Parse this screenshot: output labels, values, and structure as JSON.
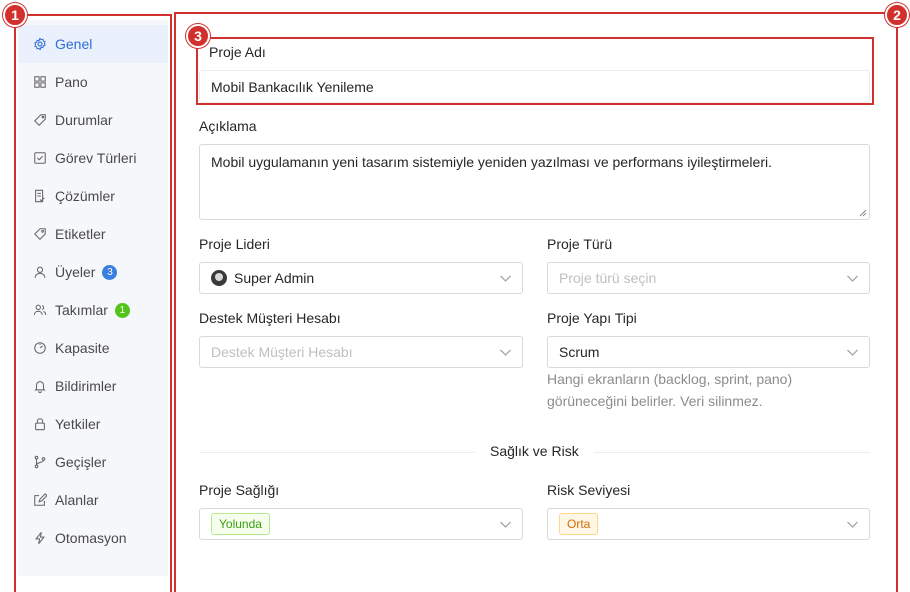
{
  "sidebar": {
    "items": [
      {
        "label": "Genel",
        "icon": "gear-icon",
        "active": true
      },
      {
        "label": "Pano",
        "icon": "grid-icon"
      },
      {
        "label": "Durumlar",
        "icon": "tag-outline-icon"
      },
      {
        "label": "Görev Türleri",
        "icon": "checkbox-icon"
      },
      {
        "label": "Çözümler",
        "icon": "document-check-icon"
      },
      {
        "label": "Etiketler",
        "icon": "label-icon"
      },
      {
        "label": "Üyeler",
        "icon": "user-icon",
        "badge": "3"
      },
      {
        "label": "Takımlar",
        "icon": "team-icon",
        "badge": "1"
      },
      {
        "label": "Kapasite",
        "icon": "gauge-icon"
      },
      {
        "label": "Bildirimler",
        "icon": "bell-icon"
      },
      {
        "label": "Yetkiler",
        "icon": "lock-icon"
      },
      {
        "label": "Geçişler",
        "icon": "branch-icon"
      },
      {
        "label": "Alanlar",
        "icon": "edit-icon"
      },
      {
        "label": "Otomasyon",
        "icon": "bolt-icon"
      }
    ]
  },
  "markers": [
    "1",
    "2",
    "3"
  ],
  "form": {
    "project_name_label": "Proje Adı",
    "project_name_value": "Mobil Bankacılık Yenileme",
    "description_label": "Açıklama",
    "description_value": "Mobil uygulamanın yeni tasarım sistemiyle yeniden yazılması ve performans iyileştirmeleri.",
    "lead_label": "Proje Lideri",
    "lead_value": "Super Admin",
    "type_label": "Proje Türü",
    "type_placeholder": "Proje türü seçin",
    "support_label": "Destek Müşteri Hesabı",
    "support_placeholder": "Destek Müşteri Hesabı",
    "structure_label": "Proje Yapı Tipi",
    "structure_value": "Scrum",
    "structure_help_line1": "Hangi ekranların (backlog, sprint, pano)",
    "structure_help_line2": "görüneceğini belirler. Veri silinmez.",
    "section_title": "Sağlık ve Risk",
    "health_label": "Proje Sağlığı",
    "health_value": "Yolunda",
    "risk_label": "Risk Seviyesi",
    "risk_value": "Orta"
  },
  "colors": {
    "accent": "#2f6fd6",
    "annotation": "#d2302c",
    "health_tag": "#389e0d",
    "risk_tag": "#d46b08"
  }
}
